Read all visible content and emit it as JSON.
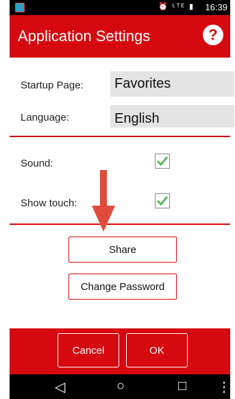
{
  "status_bar": {
    "time": "16:39",
    "icons": "⏰ ᴸᵀᴱ ▮"
  },
  "header": {
    "title": "Application Settings",
    "help_glyph": "?"
  },
  "settings": {
    "startup_page": {
      "label": "Startup Page:",
      "value": "Favorites"
    },
    "language": {
      "label": "Language:",
      "value": "English"
    },
    "sound": {
      "label": "Sound:",
      "checked": true
    },
    "show_touch": {
      "label": "Show touch:",
      "checked": true
    }
  },
  "actions": {
    "share_label": "Share",
    "change_password_label": "Change Password"
  },
  "footer": {
    "cancel_label": "Cancel",
    "ok_label": "OK"
  },
  "navbar": {
    "back": "◁",
    "home": "○",
    "recents": "□",
    "menu": "⋮"
  },
  "colors": {
    "accent": "#d5090f",
    "field_bg": "#e3e3e3",
    "check": "#5cb85c"
  }
}
